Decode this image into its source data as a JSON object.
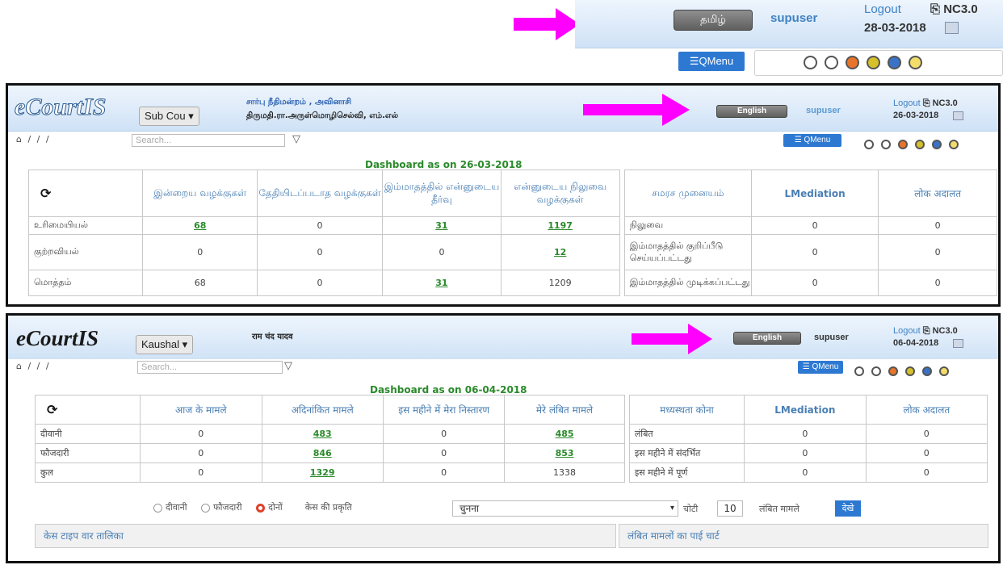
{
  "colors": {
    "arrow": "#ff00ff",
    "link": "#2a8a2a",
    "header_text": "#4a7fb4",
    "accent": "#2d79d2"
  },
  "top_crop": {
    "language_button": "தமிழ்",
    "user": "supuser",
    "logout": "Logout",
    "nc_version": "NC3.0",
    "date": "28-03-2018",
    "qmenu": "☰QMenu",
    "theme_colors": [
      "#ffffff",
      "#ffffff",
      "#e8742a",
      "#d6c02a",
      "#3a72c8",
      "#f2dd6a"
    ]
  },
  "panel1": {
    "logo": "eCourtIS",
    "court_select": "Sub Cou ▾",
    "court_name": "சார்பு நீதிமன்றம் , அவினாசி",
    "judge_name": "திருமதி.ரா.அருள்மொழிசெல்வி, எம்.எல்",
    "language_button": "English",
    "user": "supuser",
    "logout": "Logout",
    "nc_version": "NC3.0",
    "date": "26-03-2018",
    "breadcrumb": "⌂ / / /",
    "search_placeholder": "Search...",
    "qmenu": "☰ QMenu",
    "dashboard_title": "Dashboard as on 26-03-2018",
    "columns": [
      "இன்றைய வழக்குகள்",
      "தேதியிடப்படாத வழக்குகள்",
      "இம்மாதத்தில் என்னுடைய தீர்வு",
      "என்னுடைய நிலுவை வழக்குகள்"
    ],
    "rows": [
      {
        "label": "உரிமையியல்",
        "values": [
          "68",
          "0",
          "31",
          "1197"
        ]
      },
      {
        "label": "குற்றவியல்",
        "values": [
          "0",
          "0",
          "0",
          "12"
        ]
      },
      {
        "label": "மொத்தம்",
        "values": [
          "68",
          "0",
          "31",
          "1209"
        ]
      }
    ],
    "right_columns": [
      "சமரச முனையம்",
      "LMediation",
      "लोक अदालत"
    ],
    "right_rows": [
      {
        "label": "நிலுவை",
        "values": [
          "0",
          "0"
        ]
      },
      {
        "label": "இம்மாதத்தில் குறிப்பீடு செய்யப்பட்டது",
        "values": [
          "0",
          "0"
        ]
      },
      {
        "label": "இம்மாதத்தில் முடிக்கப்பட்டது",
        "values": [
          "0",
          "0"
        ]
      }
    ]
  },
  "panel2": {
    "logo": "eCourtIS",
    "court_select": "Kaushal ▾",
    "judge_name": "राम चंद यादव",
    "language_button": "English",
    "user": "supuser",
    "logout": "Logout",
    "nc_version": "NC3.0",
    "date": "06-04-2018",
    "breadcrumb": "⌂ / / /",
    "search_placeholder": "Search...",
    "qmenu": "☰ QMenu",
    "dashboard_title": "Dashboard as on 06-04-2018",
    "columns": [
      "आज के मामले",
      "अदिनांकित मामले",
      "इस महीने में मेरा निस्तारण",
      "मेरे लंबित मामले"
    ],
    "rows": [
      {
        "label": "दीवानी",
        "values": [
          "0",
          "483",
          "0",
          "485"
        ]
      },
      {
        "label": "फौजदारी",
        "values": [
          "0",
          "846",
          "0",
          "853"
        ]
      },
      {
        "label": "कुल",
        "values": [
          "0",
          "1329",
          "0",
          "1338"
        ]
      }
    ],
    "right_columns": [
      "मध्यस्थता कोना",
      "LMediation",
      "लोक अदालत"
    ],
    "right_rows": [
      {
        "label": "लंबित",
        "values": [
          "0",
          "0"
        ]
      },
      {
        "label": "इस महीने में संदर्भित",
        "values": [
          "0",
          "0"
        ]
      },
      {
        "label": "इस महीने में पूर्ण",
        "values": [
          "0",
          "0"
        ]
      }
    ],
    "options": {
      "radio_civil": "दीवानी",
      "radio_criminal": "फौजदारी",
      "radio_both": "दोनों",
      "nature_label": "केस की प्रकृति",
      "nature_value": "चुनना",
      "top_label": "चोटी",
      "top_value": "10",
      "pending_label": "लंबित मामले",
      "view_button": "देखे"
    },
    "bottom_left": "केस टाइप वार तालिका",
    "bottom_right": "लंबित मामलों का पाई चार्ट"
  }
}
